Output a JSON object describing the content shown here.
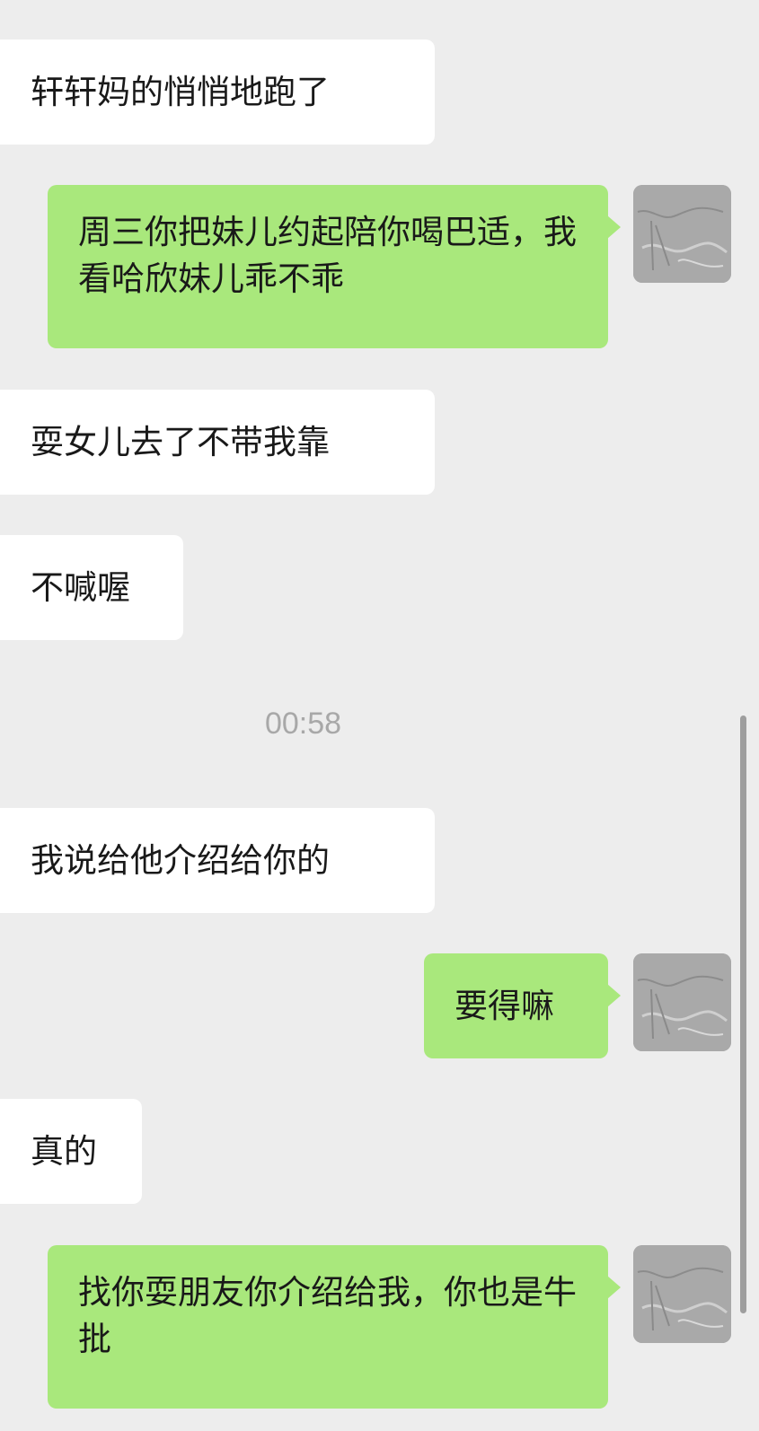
{
  "messages": [
    {
      "side": "incoming",
      "text": "轩轩妈的悄悄地跑了"
    },
    {
      "side": "outgoing",
      "text": "周三你把妹儿约起陪你喝巴适，我看哈欣妹儿乖不乖"
    },
    {
      "side": "incoming",
      "text": "耍女儿去了不带我靠"
    },
    {
      "side": "incoming",
      "text": "不喊喔"
    },
    {
      "side": "incoming",
      "text": "我说给他介绍给你的"
    },
    {
      "side": "outgoing",
      "text": "要得嘛"
    },
    {
      "side": "incoming",
      "text": "真的"
    },
    {
      "side": "outgoing",
      "text": "找你耍朋友你介绍给我，你也是牛批"
    }
  ],
  "timestamp": "00:58",
  "avatar_icon": "avatar-sketch-icon",
  "colors": {
    "background": "#ededed",
    "incoming_bubble": "#ffffff",
    "outgoing_bubble": "#a9e87c",
    "timestamp_text": "#a8a8a8"
  }
}
